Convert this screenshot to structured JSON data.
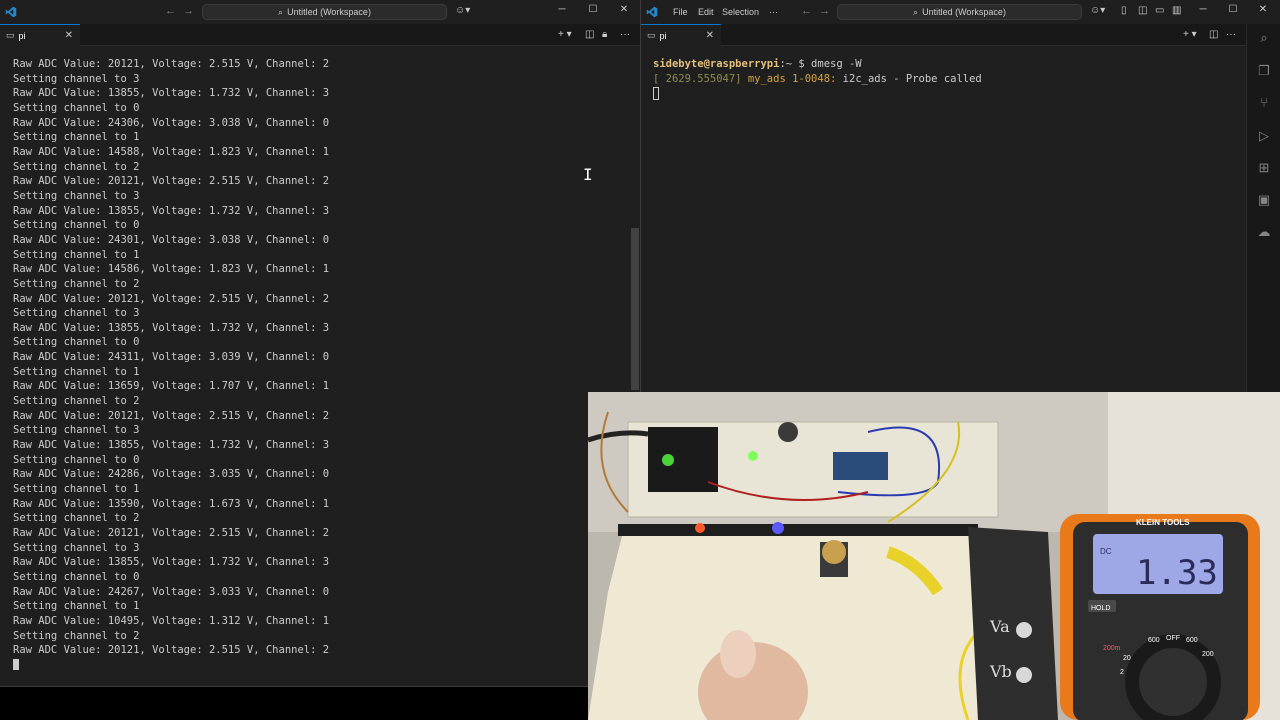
{
  "left_window": {
    "title": "Untitled (Workspace)",
    "tab_label": "pi",
    "terminal_lines": [
      "Raw ADC Value: 20121, Voltage: 2.515 V, Channel: 2",
      "Setting channel to 3",
      "Raw ADC Value: 13855, Voltage: 1.732 V, Channel: 3",
      "Setting channel to 0",
      "Raw ADC Value: 24306, Voltage: 3.038 V, Channel: 0",
      "Setting channel to 1",
      "Raw ADC Value: 14588, Voltage: 1.823 V, Channel: 1",
      "Setting channel to 2",
      "Raw ADC Value: 20121, Voltage: 2.515 V, Channel: 2",
      "Setting channel to 3",
      "Raw ADC Value: 13855, Voltage: 1.732 V, Channel: 3",
      "Setting channel to 0",
      "Raw ADC Value: 24301, Voltage: 3.038 V, Channel: 0",
      "Setting channel to 1",
      "Raw ADC Value: 14586, Voltage: 1.823 V, Channel: 1",
      "Setting channel to 2",
      "Raw ADC Value: 20121, Voltage: 2.515 V, Channel: 2",
      "Setting channel to 3",
      "Raw ADC Value: 13855, Voltage: 1.732 V, Channel: 3",
      "Setting channel to 0",
      "Raw ADC Value: 24311, Voltage: 3.039 V, Channel: 0",
      "Setting channel to 1",
      "Raw ADC Value: 13659, Voltage: 1.707 V, Channel: 1",
      "Setting channel to 2",
      "Raw ADC Value: 20121, Voltage: 2.515 V, Channel: 2",
      "Setting channel to 3",
      "Raw ADC Value: 13855, Voltage: 1.732 V, Channel: 3",
      "Setting channel to 0",
      "Raw ADC Value: 24286, Voltage: 3.035 V, Channel: 0",
      "Setting channel to 1",
      "Raw ADC Value: 13590, Voltage: 1.673 V, Channel: 1",
      "Setting channel to 2",
      "Raw ADC Value: 20121, Voltage: 2.515 V, Channel: 2",
      "Setting channel to 3",
      "Raw ADC Value: 13855, Voltage: 1.732 V, Channel: 3",
      "Setting channel to 0",
      "Raw ADC Value: 24267, Voltage: 3.033 V, Channel: 0",
      "Setting channel to 1",
      "Raw ADC Value: 10495, Voltage: 1.312 V, Channel: 1",
      "Setting channel to 2",
      "Raw ADC Value: 20121, Voltage: 2.515 V, Channel: 2"
    ]
  },
  "right_window": {
    "title": "Untitled (Workspace)",
    "menu": [
      "File",
      "Edit",
      "Selection",
      "···"
    ],
    "tab_label": "pi",
    "prompt_user": "sidebyte@raspberrypi",
    "prompt_suffix": ":~ $ ",
    "command": "dmesg -W",
    "dmesg_time": "[ 2629.555047]",
    "dmesg_device": "my_ads 1-0048:",
    "dmesg_message": " i2c_ads - Probe called"
  },
  "camera": {
    "multimeter_brand": "KLEIN TOOLS",
    "multimeter_reading": "1.33",
    "multimeter_mode": "DC",
    "hold_label": "HOLD",
    "dial_labels": [
      "600",
      "OFF",
      "600",
      "200",
      "20",
      "2",
      "200m"
    ],
    "probe_labels": [
      "Va",
      "Vb"
    ],
    "accent_orange": "#e87a1c"
  },
  "colors": {
    "accent": "#0078d4",
    "prompt_user": "#e5c07b",
    "dmesg_device": "#d6a33d"
  }
}
